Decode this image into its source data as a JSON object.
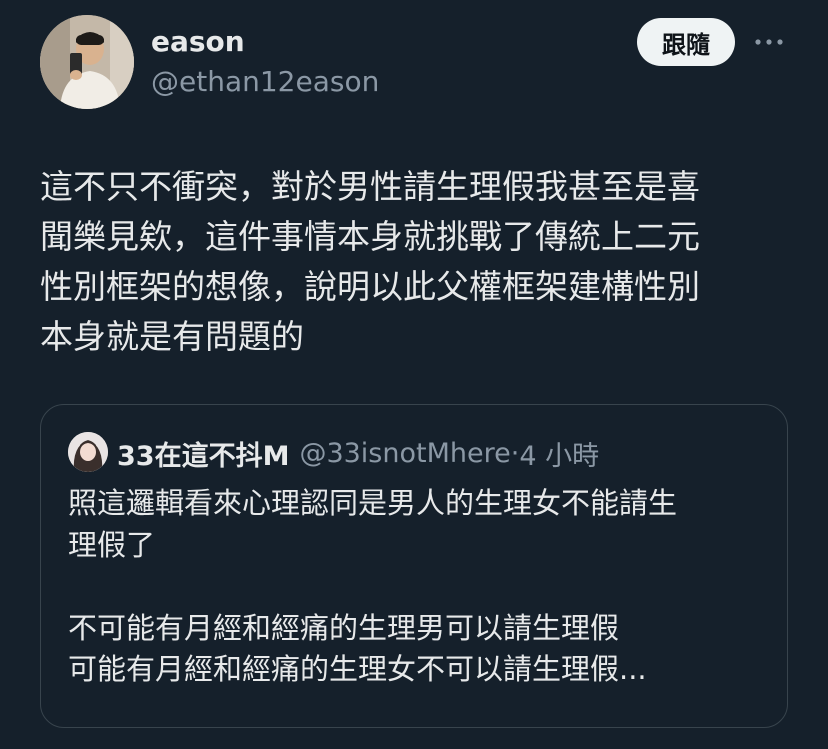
{
  "author": {
    "display_name": "eason",
    "handle": "@ethan12eason",
    "avatar_icon": "profile-photo"
  },
  "follow_button": {
    "label": "跟隨"
  },
  "more_icon": "more-horizontal-icon",
  "tweet": {
    "text": "這不只不衝突，對於男性請生理假我甚至是喜\n聞樂見欸，這件事情本身就挑戰了傳統上二元\n性別框架的想像，說明以此父權框架建構性別\n本身就是有問題的"
  },
  "quoted_tweet": {
    "display_name": "33在這不抖M",
    "handle": "@33isnotMhere",
    "separator": "·",
    "time": "4 小時",
    "text": "照這邏輯看來心理認同是男人的生理女不能請生\n理假了\n\n不可能有月經和經痛的生理男可以請生理假\n可能有月經和經痛的生理女不可以請生理假..."
  },
  "colors": {
    "background": "#15202b",
    "text_primary": "#e7e9ea",
    "text_secondary": "#8b98a5",
    "border": "#38444d",
    "button_bg": "#eff3f4"
  }
}
